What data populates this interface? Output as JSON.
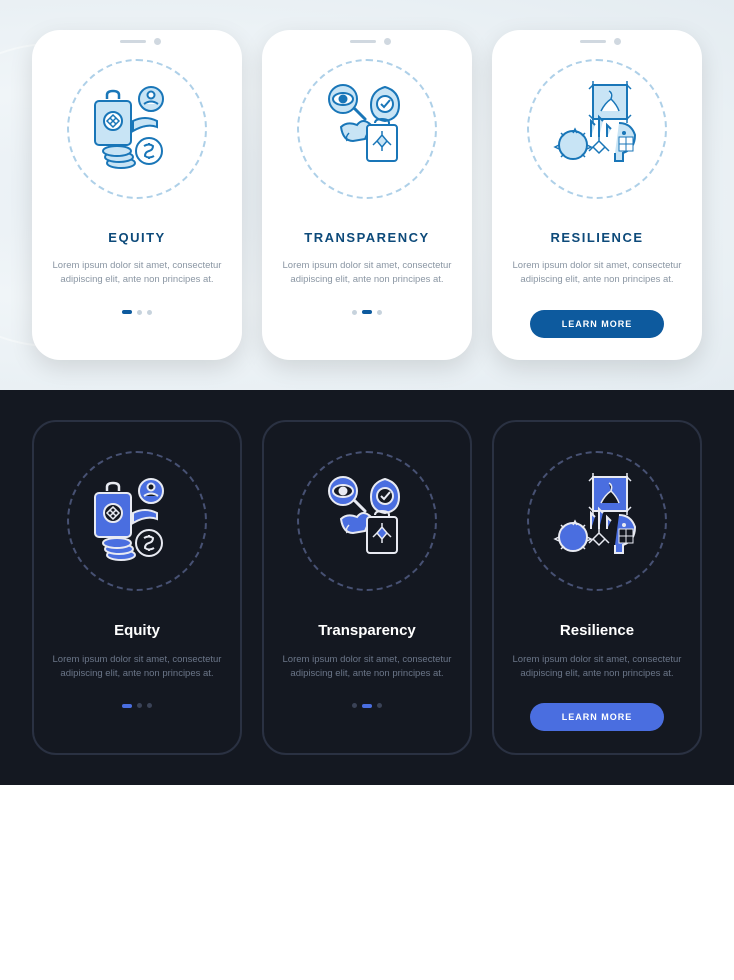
{
  "screens": [
    {
      "title_light": "EQUITY",
      "title_dark": "Equity",
      "desc": "Lorem ipsum dolor sit amet, consectetur adipiscing elit, ante non principes at.",
      "page_index": 0
    },
    {
      "title_light": "TRANSPARENCY",
      "title_dark": "Transparency",
      "desc": "Lorem ipsum dolor sit amet, consectetur adipiscing elit, ante non principes at.",
      "page_index": 1
    },
    {
      "title_light": "RESILIENCE",
      "title_dark": "Resilience",
      "desc": "Lorem ipsum dolor sit amet, consectetur adipiscing elit, ante non principes at.",
      "page_index": 2
    }
  ],
  "cta_label": "LEARN MORE",
  "colors": {
    "light_primary": "#0d5a9e",
    "light_icon_stroke": "#1976b8",
    "light_icon_fill": "#87c5eb",
    "dark_primary": "#4a6ee0",
    "dark_icon_fill": "#4a6ee0",
    "dark_icon_stroke": "#e8eaf2"
  }
}
